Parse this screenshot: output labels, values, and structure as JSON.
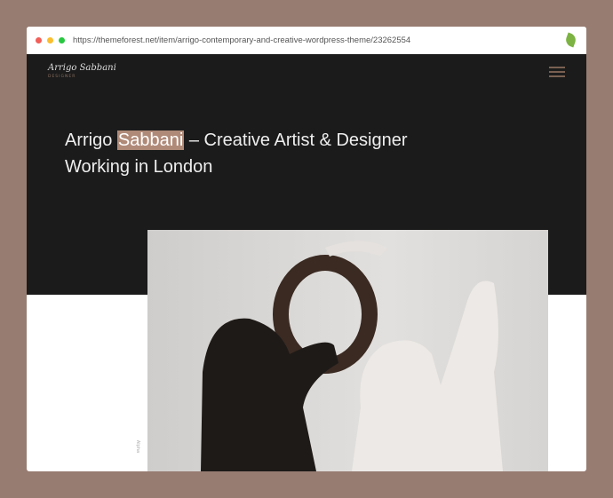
{
  "browser": {
    "url": "https://themeforest.net/item/arrigo-contemporary-and-creative-wordpress-theme/23262554",
    "dots": [
      "#f25f58",
      "#fbbe2e",
      "#27c840"
    ]
  },
  "site": {
    "logo": "Arrigo Sabbani",
    "tagline": "DESIGNER"
  },
  "hero": {
    "title_pre": "Arrigo ",
    "title_highlight": "Sabbani",
    "title_post": " – Creative Artist & Designer",
    "title_line2": "Working in London"
  },
  "photo": {
    "caption": "Alpha"
  }
}
